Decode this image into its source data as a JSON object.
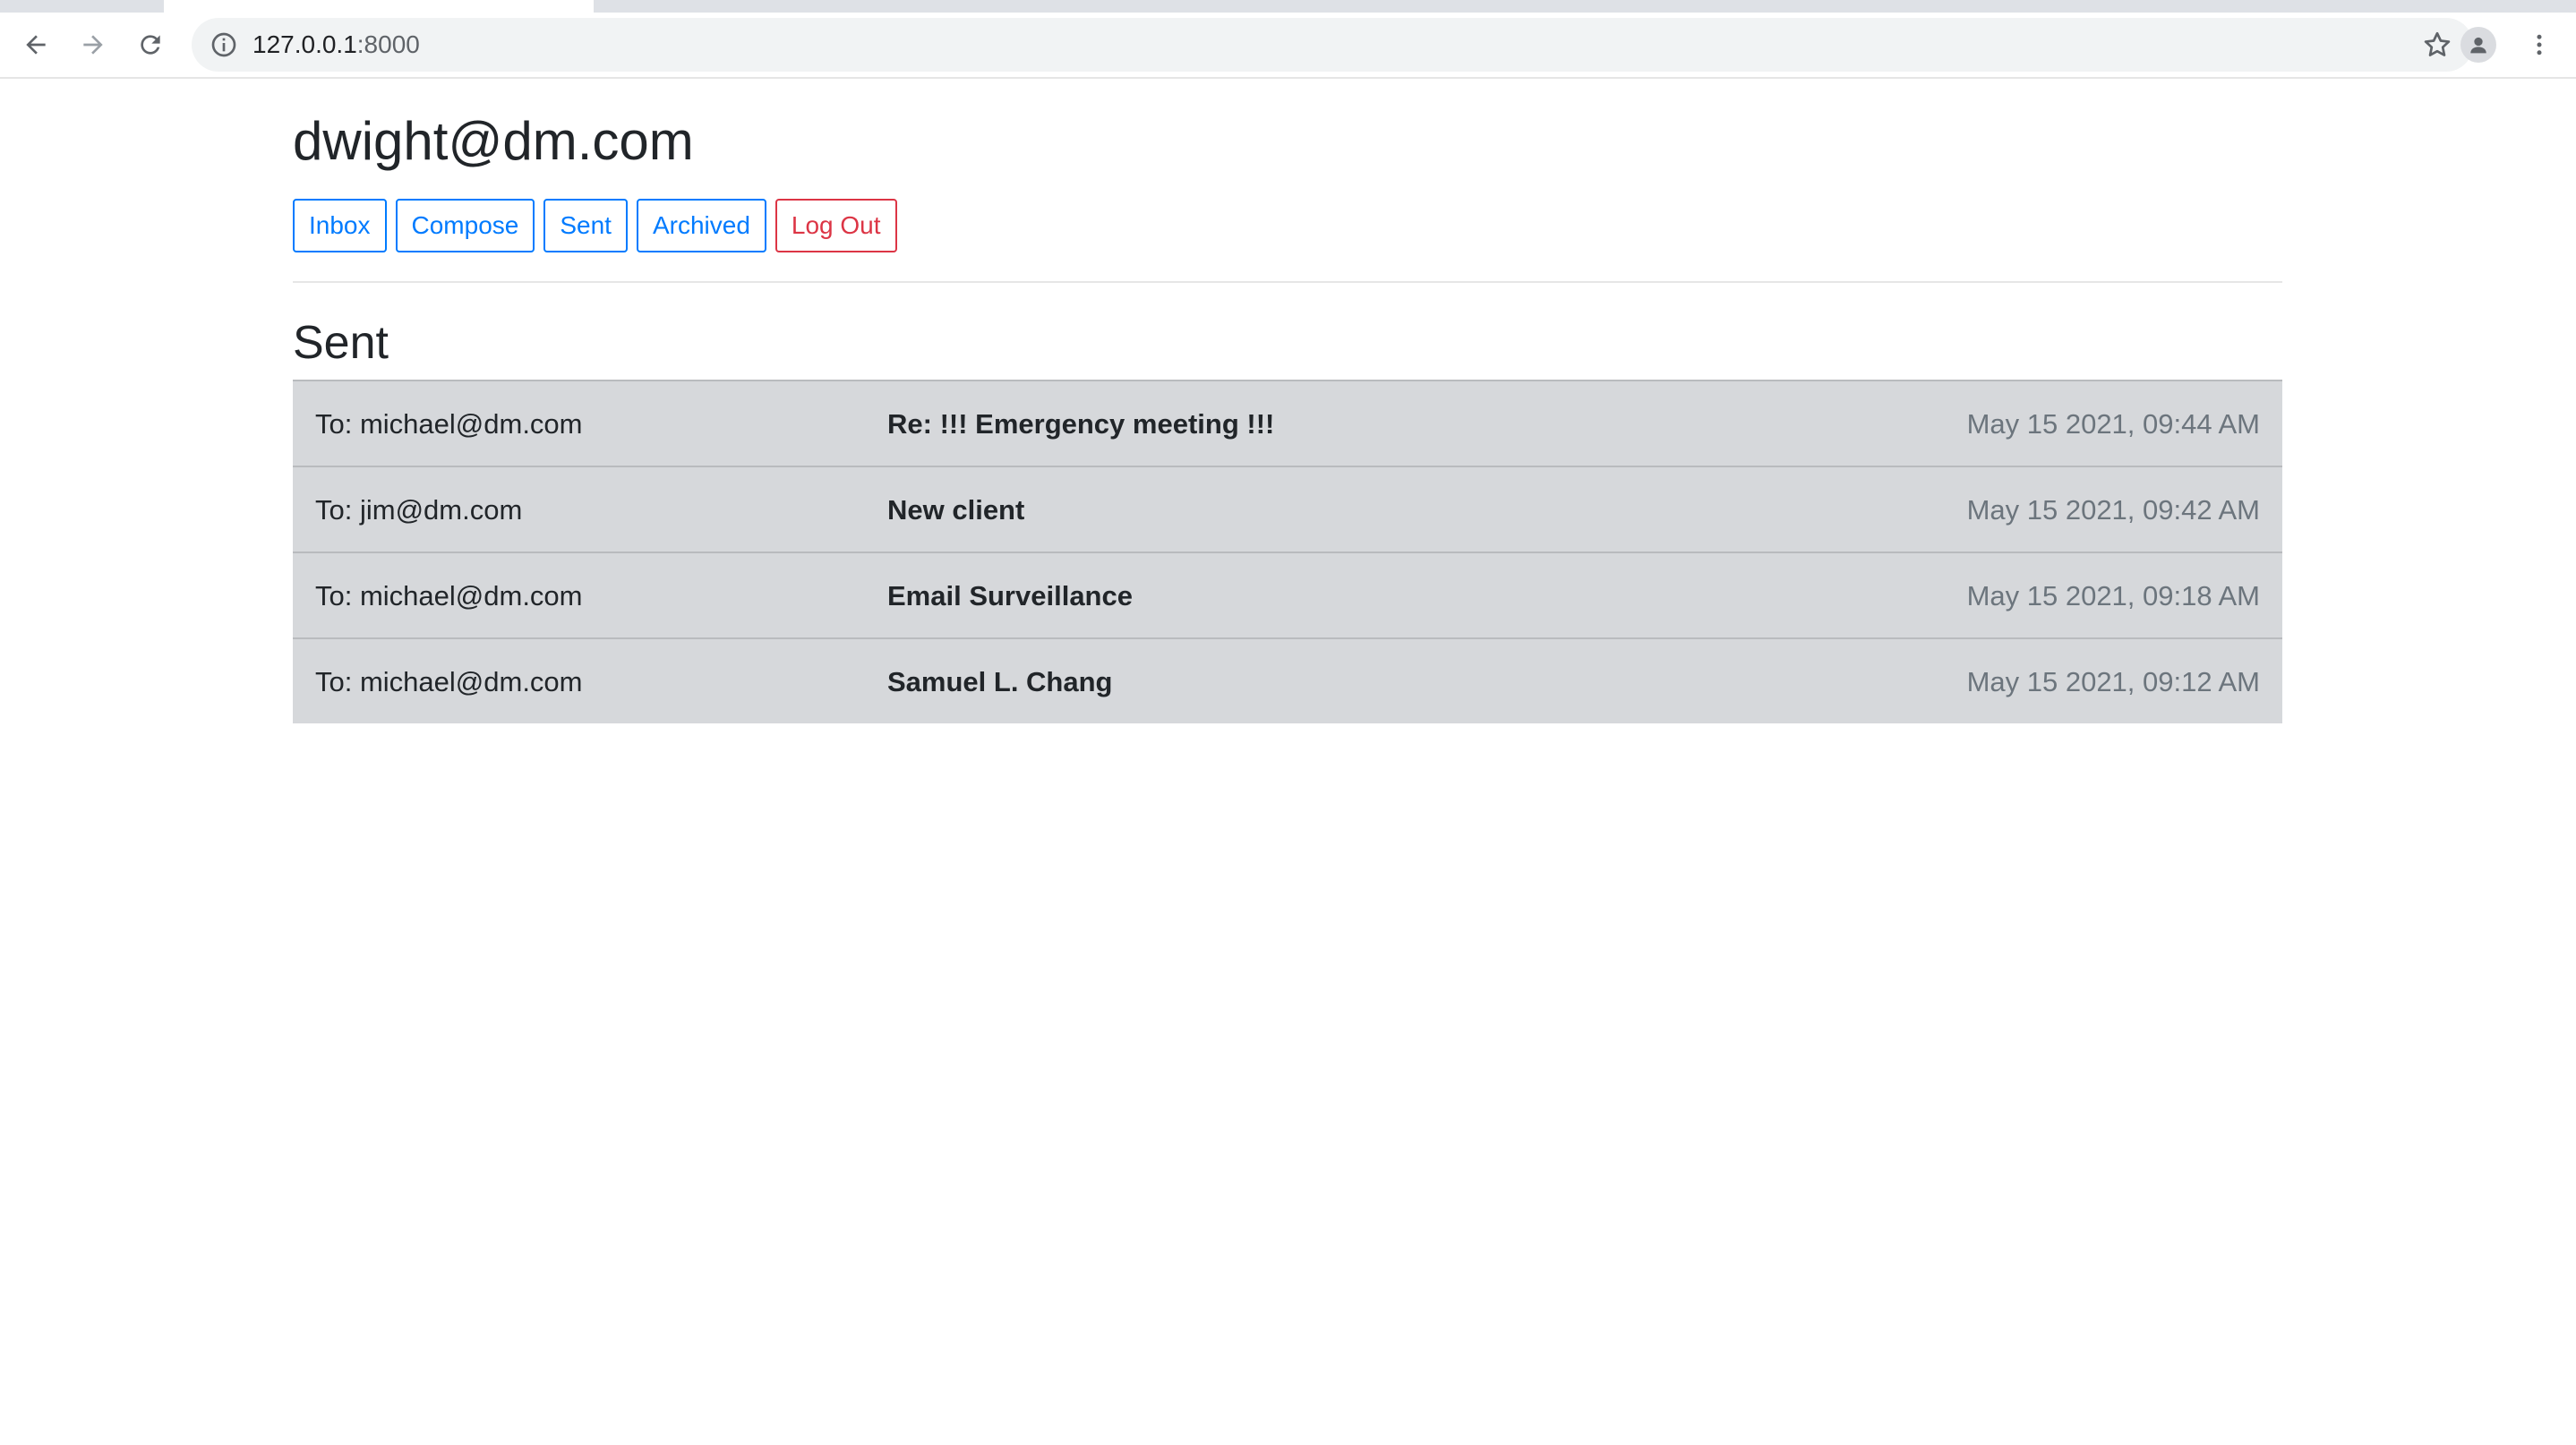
{
  "browser": {
    "url_host": "127.0.0.1",
    "url_port": ":8000"
  },
  "header": {
    "user_email": "dwight@dm.com"
  },
  "nav_buttons": {
    "inbox": "Inbox",
    "compose": "Compose",
    "sent": "Sent",
    "archived": "Archived",
    "logout": "Log Out"
  },
  "mailbox": {
    "title": "Sent",
    "emails": [
      {
        "recipient": "To: michael@dm.com",
        "subject": "Re: !!! Emergency meeting !!!",
        "timestamp": "May 15 2021, 09:44 AM"
      },
      {
        "recipient": "To: jim@dm.com",
        "subject": "New client",
        "timestamp": "May 15 2021, 09:42 AM"
      },
      {
        "recipient": "To: michael@dm.com",
        "subject": "Email Surveillance",
        "timestamp": "May 15 2021, 09:18 AM"
      },
      {
        "recipient": "To: michael@dm.com",
        "subject": "Samuel L. Chang",
        "timestamp": "May 15 2021, 09:12 AM"
      }
    ]
  },
  "colors": {
    "primary": "#007bff",
    "danger": "#dc3545",
    "row_background": "#d6d8db",
    "muted_text": "#6c757d"
  },
  "icons": {
    "back": "arrow-left-icon",
    "forward": "arrow-right-icon",
    "reload": "reload-icon",
    "site_info": "info-icon",
    "bookmark": "star-icon",
    "profile": "person-icon",
    "menu": "kebab-menu-icon"
  }
}
